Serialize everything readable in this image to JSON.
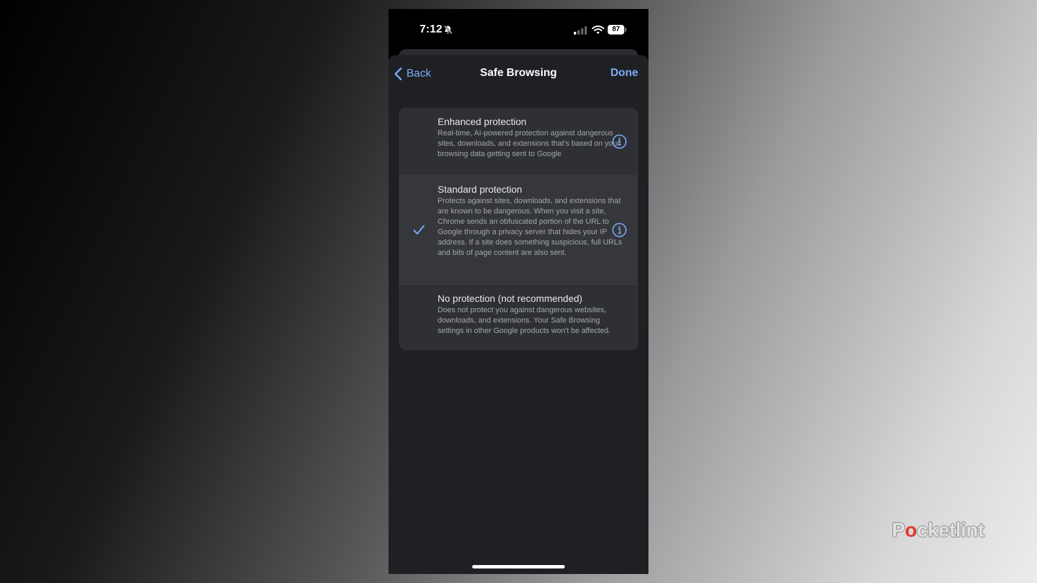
{
  "status_bar": {
    "time": "7:12",
    "battery": "87",
    "icons": [
      "bell-slash-icon",
      "signal-icon",
      "wifi-icon",
      "battery-icon"
    ]
  },
  "nav": {
    "back_label": "Back",
    "title": "Safe Browsing",
    "done_label": "Done"
  },
  "options": [
    {
      "title": "Enhanced protection",
      "description": "Real-time, AI-powered protection against dangerous sites, downloads, and extensions that's based on your browsing data getting sent to Google",
      "selected": false
    },
    {
      "title": "Standard protection",
      "description": "Protects against sites, downloads, and extensions that are known to be dangerous. When you visit a site, Chrome sends an obfuscated portion of the URL to Google through a privacy server that hides your IP address. If a site does something suspicious, full URLs and bits of page content are also sent.",
      "selected": true
    },
    {
      "title": "No protection (not recommended)",
      "description": "Does not protect you against dangerous websites, downloads, and extensions. Your Safe Browsing settings in other Google products won't be affected.",
      "selected": false
    }
  ],
  "watermark": {
    "before": "P",
    "dot": "o",
    "after": "cketlint"
  },
  "colors": {
    "accent": "#7cacf8",
    "sheet_bg": "#1f2024",
    "group_bg": "#2e3035",
    "text_primary": "#e8eaed",
    "text_secondary": "#a4a7ad"
  }
}
